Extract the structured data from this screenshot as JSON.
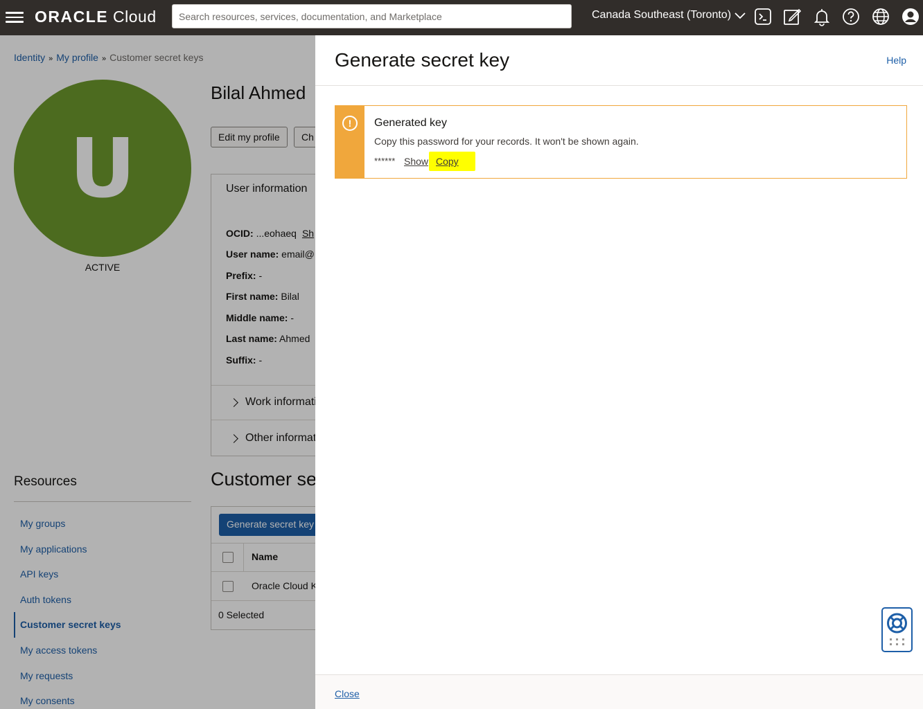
{
  "topbar": {
    "brand_bold": "ORACLE",
    "brand_light": "Cloud",
    "search_placeholder": "Search resources, services, documentation, and Marketplace",
    "region": "Canada Southeast (Toronto)"
  },
  "breadcrumb": {
    "items": [
      "Identity",
      "My profile",
      "Customer secret keys"
    ],
    "separator": "»"
  },
  "profile": {
    "avatar_letter": "U",
    "avatar_color": "#6e9a2d",
    "status": "ACTIVE",
    "name": "Bilal Ahmed",
    "edit_button": "Edit my profile",
    "second_button": "Ch"
  },
  "user_info": {
    "title": "User information",
    "ocid_label": "OCID:",
    "ocid_value": "...eohaeq",
    "ocid_link": "Sh",
    "username_label": "User name:",
    "username_value": "email@",
    "prefix_label": "Prefix:",
    "prefix_value": "-",
    "first_label": "First name:",
    "first_value": "Bilal",
    "middle_label": "Middle name:",
    "middle_value": "-",
    "last_label": "Last name:",
    "last_value": "Ahmed",
    "suffix_label": "Suffix:",
    "suffix_value": "-",
    "work_info": "Work informati",
    "other_info": "Other informat"
  },
  "resources": {
    "title": "Resources",
    "items": [
      "My groups",
      "My applications",
      "API keys",
      "Auth tokens",
      "Customer secret keys",
      "My access tokens",
      "My requests",
      "My consents"
    ],
    "active_index": 4
  },
  "secret_keys": {
    "title": "Customer se",
    "generate_button": "Generate secret key",
    "col_name": "Name",
    "row_name": "Oracle Cloud K",
    "selected": "0 Selected"
  },
  "panel": {
    "title": "Generate secret key",
    "help": "Help",
    "alert_title": "Generated key",
    "alert_message": "Copy this password for your records. It won't be shown again.",
    "masked_key": "******",
    "show_link": "Show",
    "copy_link": "Copy",
    "close": "Close"
  },
  "colors": {
    "topbar": "#312d2a",
    "link": "#1e5fa8",
    "warning": "#f0a73c",
    "highlight": "#ffff00"
  }
}
